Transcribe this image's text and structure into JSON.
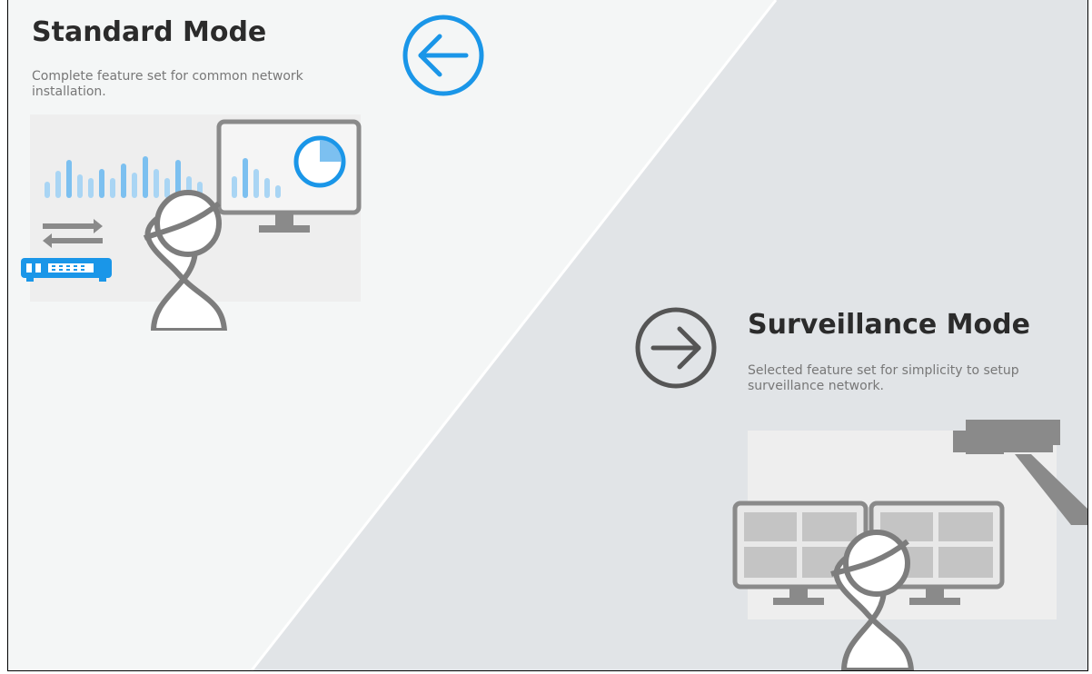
{
  "standard": {
    "title": "Standard Mode",
    "description": "Complete feature set for common network installation.",
    "back_icon": "arrow-left-circle-icon",
    "illustration": "network-monitoring-illustration"
  },
  "surveillance": {
    "title": "Surveillance Mode",
    "description": "Selected feature set for simplicity to setup surveillance network.",
    "next_icon": "arrow-right-circle-icon",
    "illustration": "surveillance-monitoring-illustration"
  },
  "colors": {
    "accent_blue": "#1a96e8",
    "light_blue": "#9fd0f3",
    "icon_gray": "#555555",
    "illus_gray": "#7d7d7d",
    "left_bg": "#f4f6f6",
    "right_bg": "#e1e4e7"
  }
}
